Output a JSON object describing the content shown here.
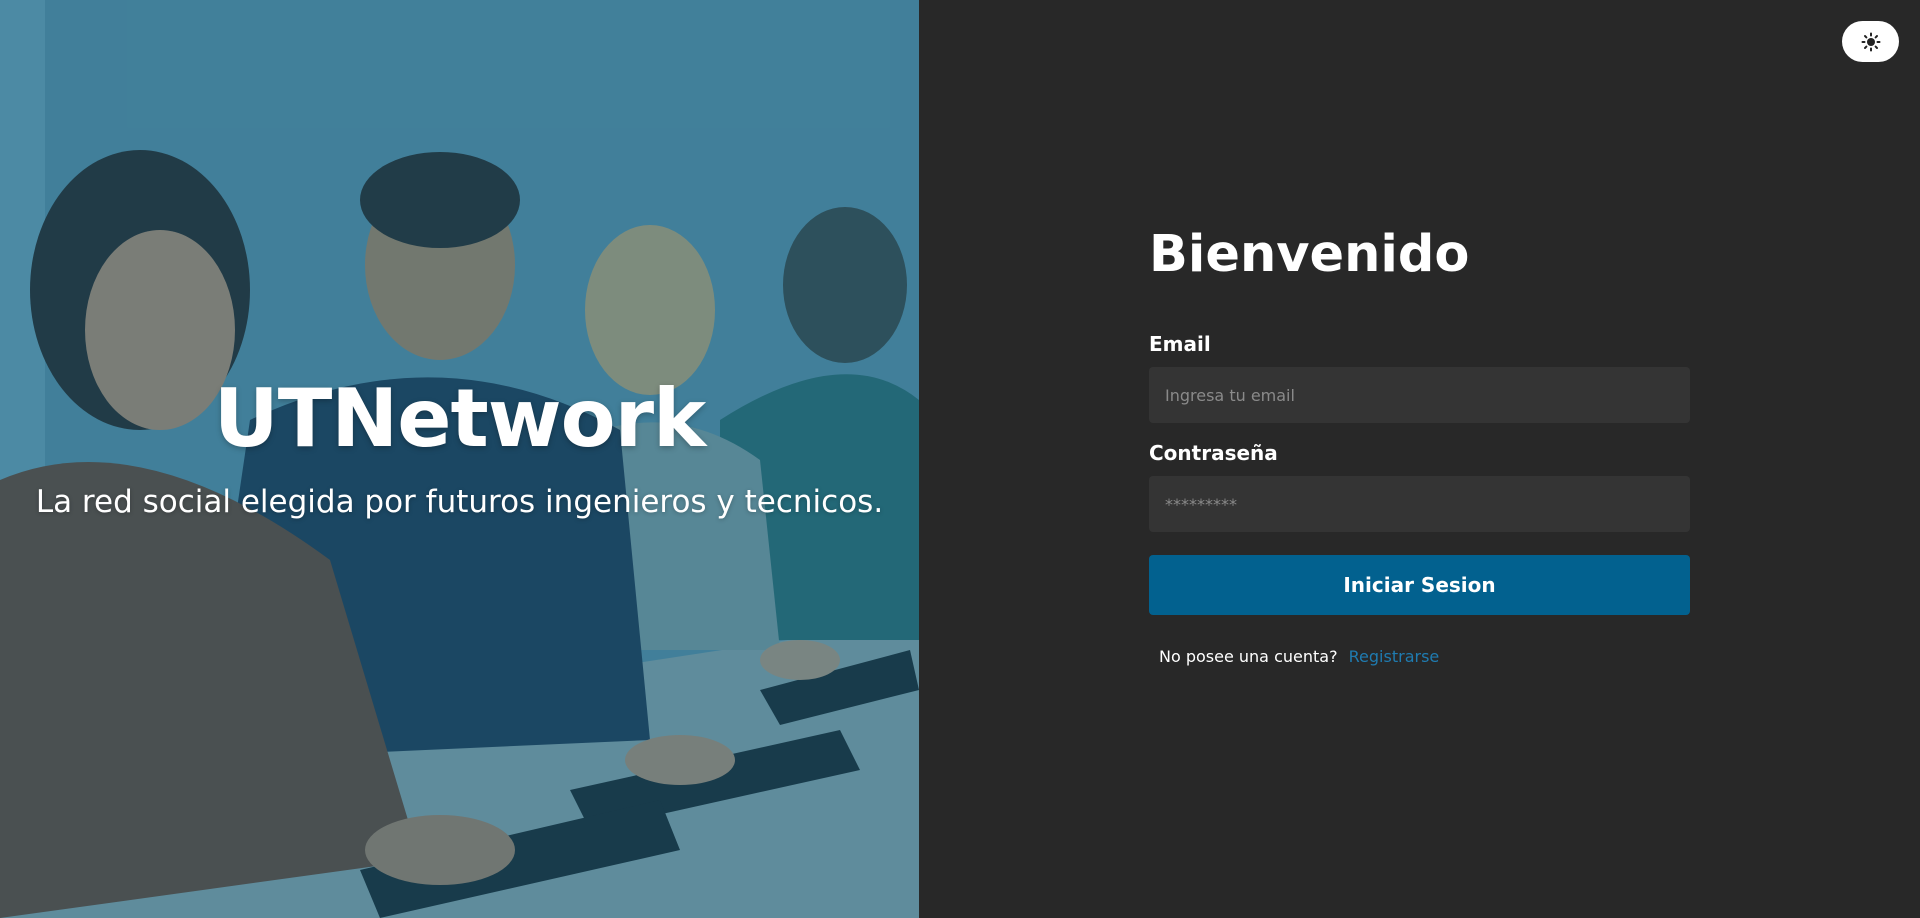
{
  "hero": {
    "title": "UTNetwork",
    "subtitle": "La red social elegida por futuros ingenieros y tecnicos."
  },
  "theme_toggle": {
    "icon": "sun-icon"
  },
  "login": {
    "heading": "Bienvenido",
    "email_label": "Email",
    "email_placeholder": "Ingresa tu email",
    "password_label": "Contraseña",
    "password_placeholder": "*********",
    "submit_label": "Iniciar Sesion",
    "register_prompt": "No posee una cuenta?",
    "register_link": "Registrarse"
  },
  "colors": {
    "panel_bg": "#282828",
    "input_bg": "#343434",
    "primary": "#02618f",
    "link": "#1f7bb0"
  }
}
